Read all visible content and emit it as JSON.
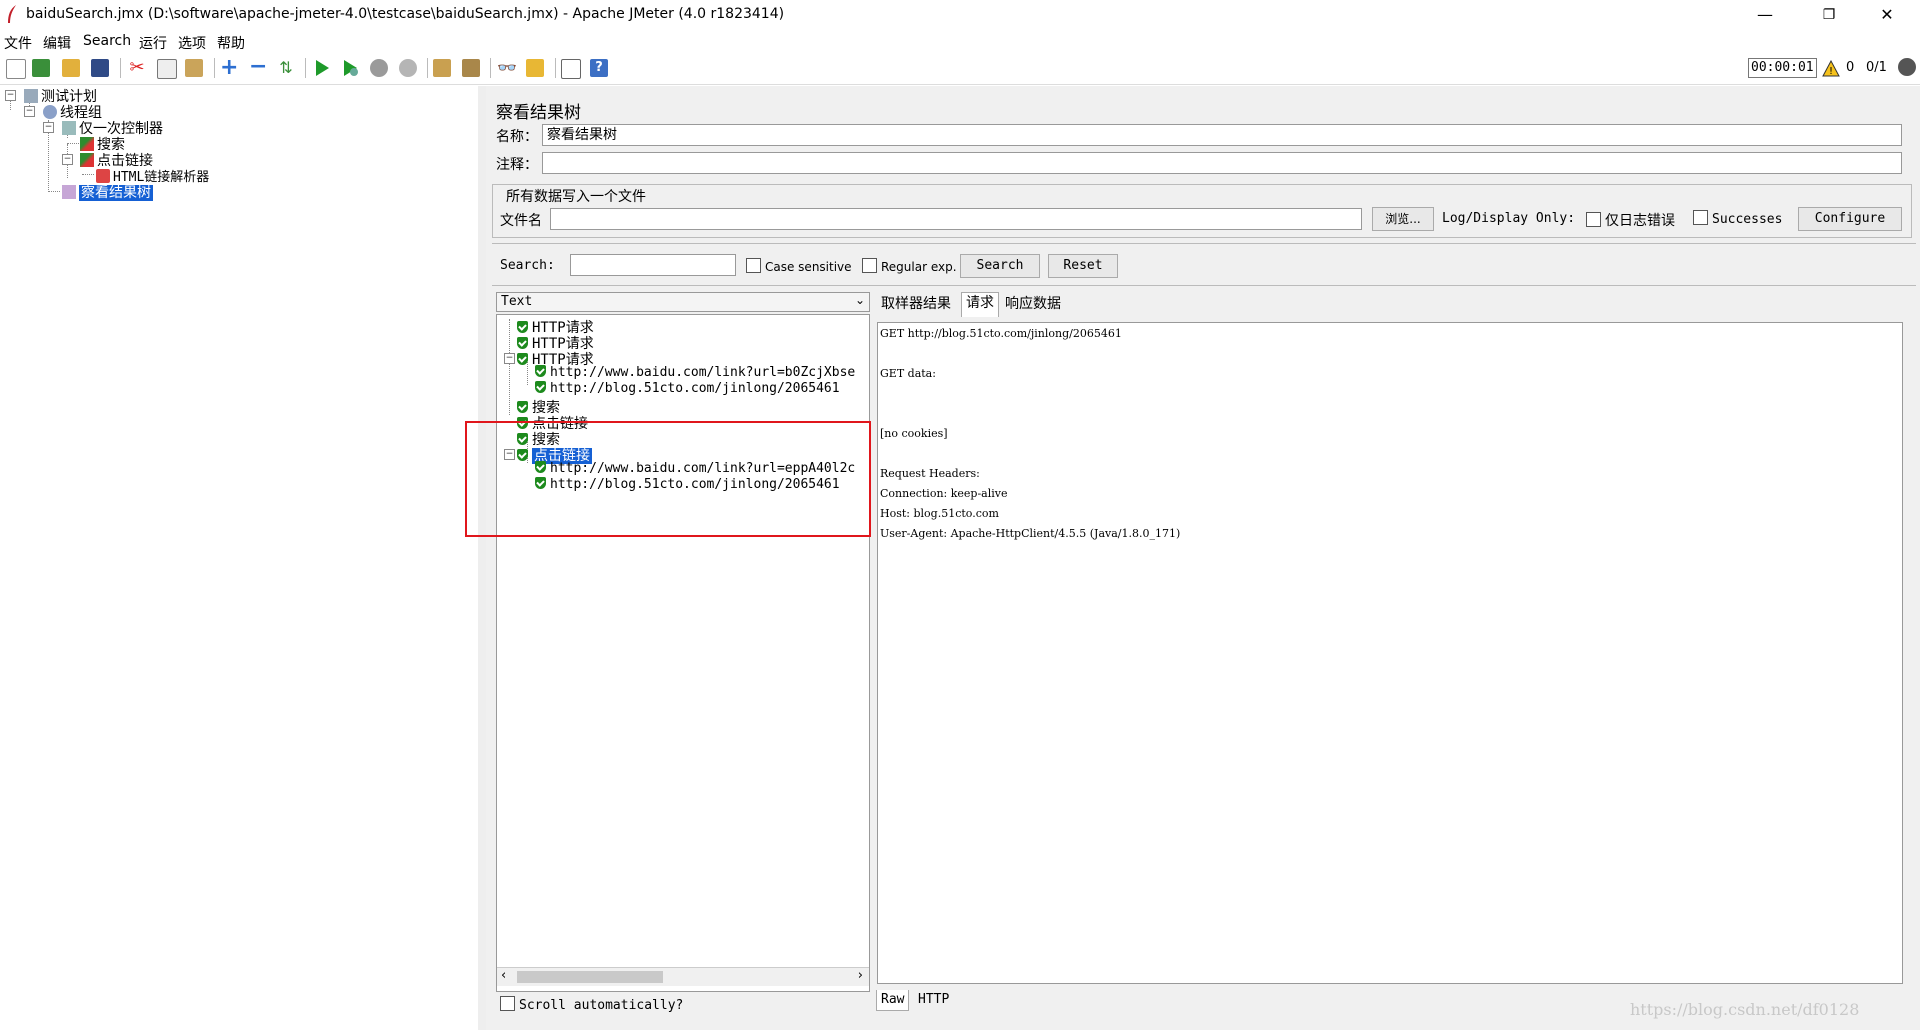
{
  "window": {
    "title": "baiduSearch.jmx (D:\\software\\apache-jmeter-4.0\\testcase\\baiduSearch.jmx) - Apache JMeter (4.0 r1823414)",
    "minimize": "—",
    "maximize": "❐",
    "close": "✕"
  },
  "menu": [
    "文件",
    "编辑",
    "Search",
    "运行",
    "选项",
    "帮助"
  ],
  "toolbar": {
    "timer": "00:00:01",
    "warn_count": "0",
    "threads": "0/1"
  },
  "tree": {
    "plan": "测试计划",
    "thread_group": "线程组",
    "once_controller": "仅一次控制器",
    "search": "搜索",
    "click_link": "点击链接",
    "html_parser": "HTML链接解析器",
    "view_results": "察看结果树"
  },
  "panel": {
    "title": "察看结果树",
    "name_label": "名称：",
    "name_value": "察看结果树",
    "comment_label": "注释：",
    "comment_value": "",
    "write_all": "所有数据写入一个文件",
    "filename_label": "文件名",
    "filename_value": "",
    "browse": "浏览...",
    "log_display": "Log/Display Only:",
    "errors_only": "仅日志错误",
    "successes": "Successes",
    "configure": "Configure"
  },
  "search": {
    "label": "Search:",
    "value": "",
    "case_sensitive": "Case sensitive",
    "regular_exp": "Regular exp.",
    "search_btn": "Search",
    "reset_btn": "Reset"
  },
  "results": {
    "renderer": "Text",
    "items": [
      "HTTP请求",
      "HTTP请求",
      "HTTP请求",
      "http://www.baidu.com/link?url=b0ZcjXbse",
      "http://blog.51cto.com/jinlong/2065461",
      "搜索",
      "点击链接",
      "搜索",
      "点击链接",
      "http://www.baidu.com/link?url=eppA40l2c",
      "http://blog.51cto.com/jinlong/2065461"
    ],
    "scroll_auto": "Scroll automatically?"
  },
  "tabs": [
    "取样器结果",
    "请求",
    "响应数据"
  ],
  "detail_lines": [
    "GET http://blog.51cto.com/jinlong/2065461",
    "GET data:",
    "[no cookies]",
    "Request Headers:",
    "Connection: keep-alive",
    "Host: blog.51cto.com",
    "User-Agent: Apache-HttpClient/4.5.5 (Java/1.8.0_171)"
  ],
  "bottom_tabs": [
    "Raw",
    "HTTP"
  ],
  "watermark": "https://blog.csdn.net/df0128"
}
